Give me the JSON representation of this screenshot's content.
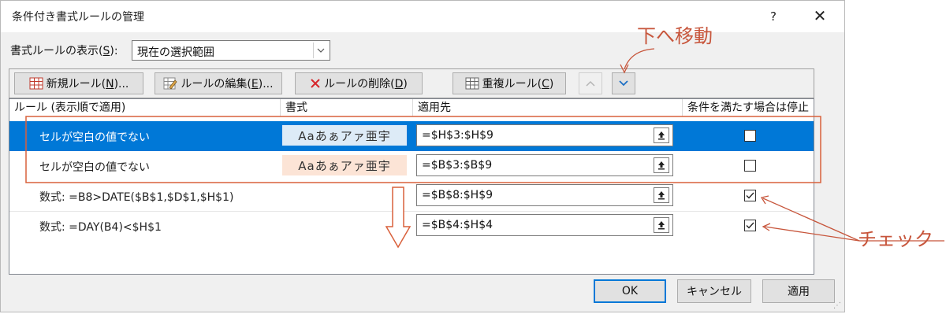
{
  "window": {
    "title": "条件付き書式ルールの管理",
    "help_label": "?",
    "close_label": "✕"
  },
  "show_rules": {
    "label_pre": "書式ルールの表示(",
    "label_key": "S",
    "label_post": "):",
    "value": "現在の選択範囲"
  },
  "toolbar": {
    "new_pre": "新規ルール(",
    "new_key": "N",
    "new_post": ")...",
    "edit_pre": "ルールの編集(",
    "edit_key": "E",
    "edit_post": ")...",
    "delete_pre": "ルールの削除(",
    "delete_key": "D",
    "delete_post": ")",
    "dup_pre": "重複ルール(",
    "dup_key": "C",
    "dup_post": ")"
  },
  "columns": {
    "rule": "ルール (表示順で適用)",
    "format": "書式",
    "applies_to": "適用先",
    "stop_if_true": "条件を満たす場合は停止"
  },
  "rules": [
    {
      "text": "セルが空白の値でない",
      "format_preview": "Aaあぁアァ亜宇",
      "format_bg": "#ddebf7",
      "applies_to": "=$H$3:$H$9",
      "stop": false,
      "selected": true
    },
    {
      "text": "セルが空白の値でない",
      "format_preview": "Aaあぁアァ亜宇",
      "format_bg": "#fce4d6",
      "applies_to": "=$B$3:$B$9",
      "stop": false,
      "selected": false
    },
    {
      "text": "数式: =B8>DATE($B$1,$D$1,$H$1)",
      "format_preview": "",
      "format_bg": "",
      "applies_to": "=$B$8:$H$9",
      "stop": true,
      "selected": false
    },
    {
      "text": "数式: =DAY(B4)<$H$1",
      "format_preview": "",
      "format_bg": "",
      "applies_to": "=$B$4:$H$4",
      "stop": true,
      "selected": false
    }
  ],
  "buttons": {
    "ok": "OK",
    "cancel": "キャンセル",
    "apply": "適用"
  },
  "annotations": {
    "move_down": "下へ移動",
    "check": "チェック"
  },
  "colors": {
    "selection": "#0078d7",
    "annotation": "#c7553b"
  }
}
